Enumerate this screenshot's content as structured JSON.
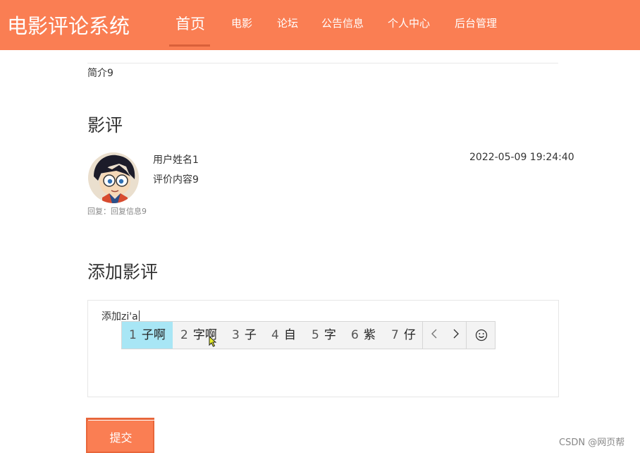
{
  "header": {
    "brand": "电影评论系统",
    "nav": [
      {
        "label": "首页",
        "active": true
      },
      {
        "label": "电影"
      },
      {
        "label": "论坛"
      },
      {
        "label": "公告信息"
      },
      {
        "label": "个人中心"
      },
      {
        "label": "后台管理"
      }
    ],
    "colors": {
      "bar": "#fa7e53",
      "underline": "#d9603a"
    }
  },
  "intro": "简介9",
  "reviews_section": {
    "title": "影评",
    "items": [
      {
        "username": "用户姓名1",
        "content": "评价内容9",
        "time": "2022-05-09 19:24:40",
        "reply": "回复：回复信息9",
        "avatar_icon": "cartoon-avatar"
      }
    ]
  },
  "add_review": {
    "title": "添加影评",
    "input_value": "添加zi'a",
    "submit_label": "提交"
  },
  "ime": {
    "candidates": [
      {
        "num": "1",
        "text": "子啊",
        "selected": true
      },
      {
        "num": "2",
        "text": "字啊"
      },
      {
        "num": "3",
        "text": "子"
      },
      {
        "num": "4",
        "text": "自"
      },
      {
        "num": "5",
        "text": "字"
      },
      {
        "num": "6",
        "text": "紫"
      },
      {
        "num": "7",
        "text": "仔"
      }
    ],
    "prev_icon": "chevron-left-icon",
    "next_icon": "chevron-right-icon",
    "emoji_icon": "smiley-icon",
    "selected_color": "#a8e6f5"
  },
  "watermark": "CSDN @网页帮"
}
